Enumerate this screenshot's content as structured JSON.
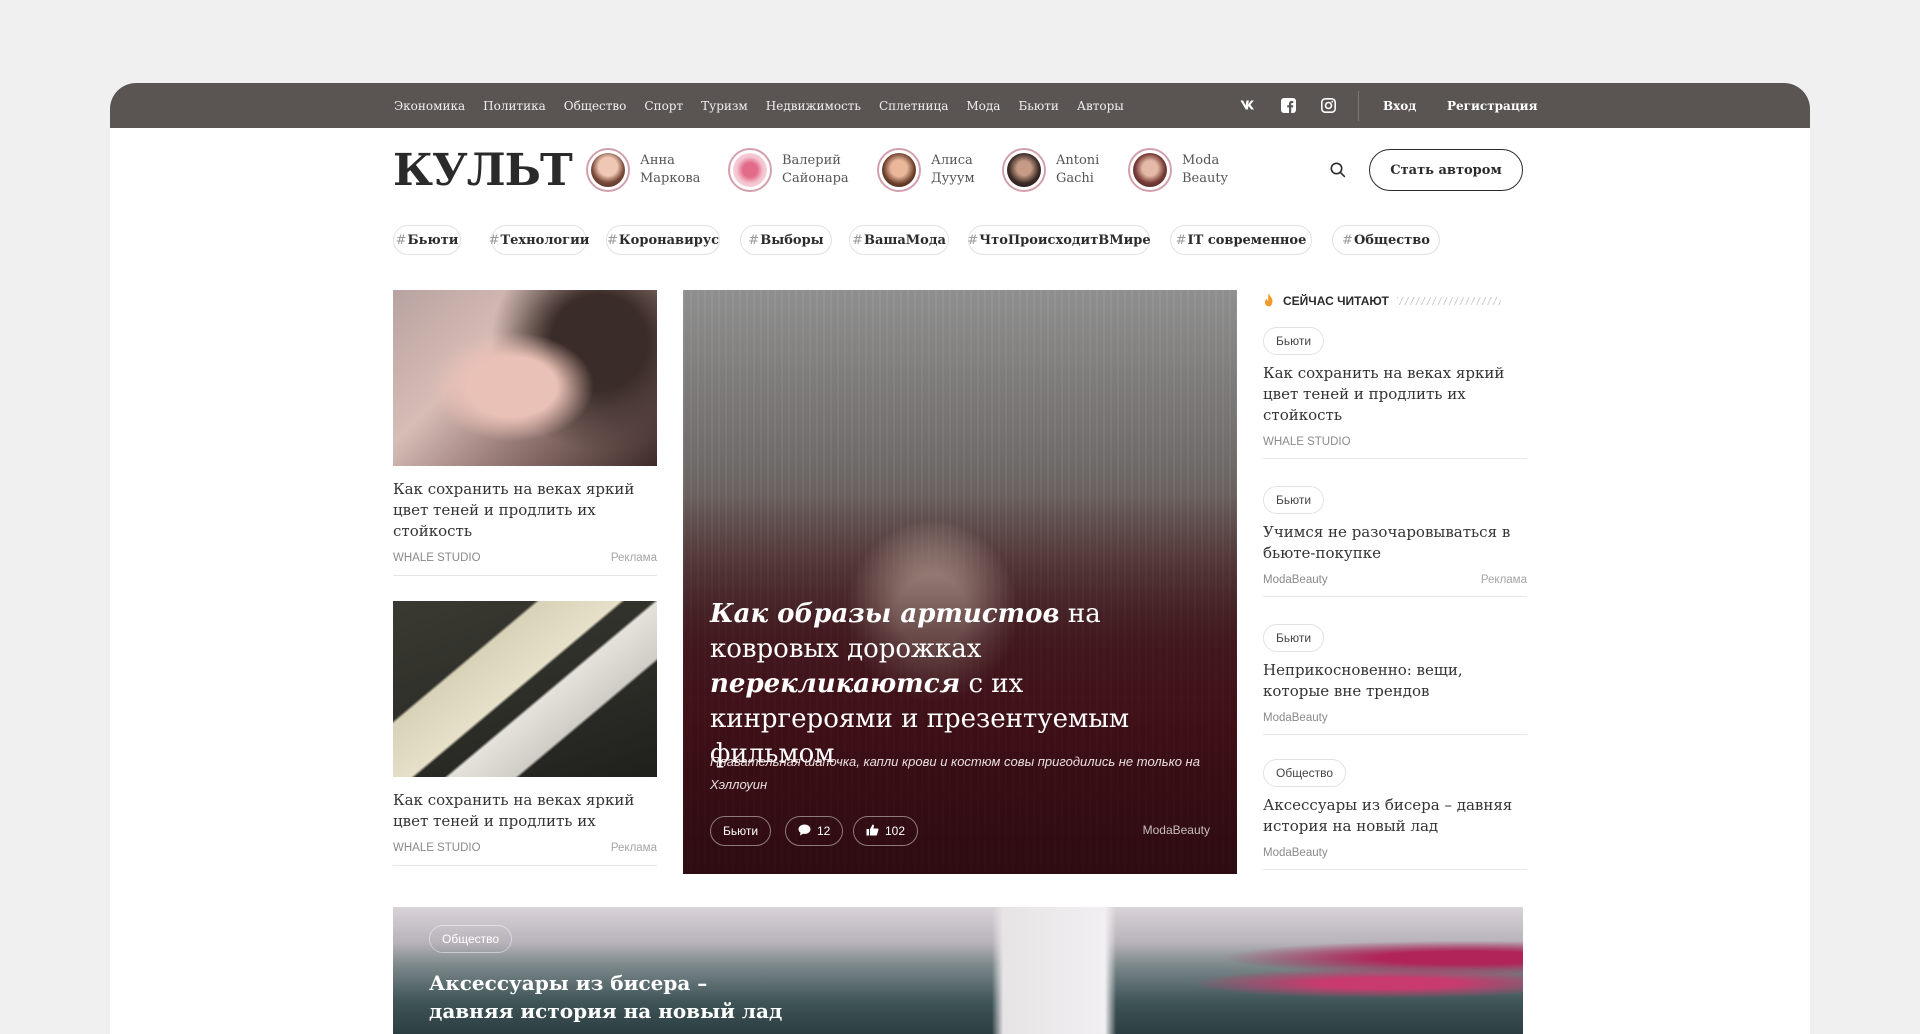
{
  "nav": {
    "items": [
      "Экономика",
      "Политика",
      "Общество",
      "Спорт",
      "Туризм",
      "Недвижимость",
      "Сплетница",
      "Мода",
      "Бьюти",
      "Авторы"
    ],
    "login": "Вход",
    "register": "Регистрация"
  },
  "logo": "КУЛЬТ",
  "authors": [
    {
      "first": "Анна",
      "last": "Маркова"
    },
    {
      "first": "Валерий",
      "last": "Сайонара"
    },
    {
      "first": "Алиса",
      "last": "Дууум"
    },
    {
      "first": "Antoni",
      "last": "Gachi"
    },
    {
      "first": "Moda",
      "last": "Beauty"
    }
  ],
  "become_author": "Стать автором",
  "tags": [
    "Бьюти",
    "Технологии",
    "Коронавирус",
    "Выборы",
    "ВашаМода",
    "ЧтоПроисходитВМире",
    "IT современное",
    "Общество"
  ],
  "tag_hash": "#",
  "left_cards": [
    {
      "title": "Как сохранить на веках яркий цвет теней и продлить их стойкость",
      "source": "WHALE STUDIO",
      "ad": "Реклама"
    },
    {
      "title": "Как сохранить на веках яркий цвет теней и продлить их",
      "source": "WHALE STUDIO",
      "ad": "Реклама"
    }
  ],
  "hero": {
    "title_b1": "Как образы артистов",
    "title_t1": " на ковровых дорожках ",
    "title_b2": "перекликаются",
    "title_t2": " с их кинргероями и презентуемым фильмом",
    "subtitle": "Плавательная шапочка, капли крови и костюм совы пригодились не только на Хэллоуин",
    "tag": "Бьюти",
    "comments": "12",
    "likes": "102",
    "source": "ModaBeauty"
  },
  "side": {
    "heading": "СЕЙЧАС ЧИТАЮТ",
    "items": [
      {
        "tag": "Бьюти",
        "title": "Как сохранить на веках яркий цвет теней и продлить их стойкость",
        "source": "WHALE STUDIO",
        "ad": ""
      },
      {
        "tag": "Бьюти",
        "title": "Учимся не разочаровываться в бьюте-покупке",
        "source": "ModaBeauty",
        "ad": "Реклама"
      },
      {
        "tag": "Бьюти",
        "title": "Неприкосновенно: вещи, которые вне трендов",
        "source": "ModaBeauty",
        "ad": ""
      },
      {
        "tag": "Общество",
        "title": "Аксессуары из бисера – давняя история на новый лад",
        "source": "ModaBeauty",
        "ad": ""
      }
    ]
  },
  "banner": {
    "tag": "Общество",
    "title": "Аксессуары из бисера – давняя история на новый лад"
  },
  "colors": {
    "topbar": "#5a5453",
    "accent": "#f29a2e",
    "page": "#f0f0f0"
  },
  "icons": [
    "vk-icon",
    "facebook-icon",
    "instagram-icon",
    "search-icon",
    "fire-icon",
    "comment-icon",
    "like-icon"
  ]
}
